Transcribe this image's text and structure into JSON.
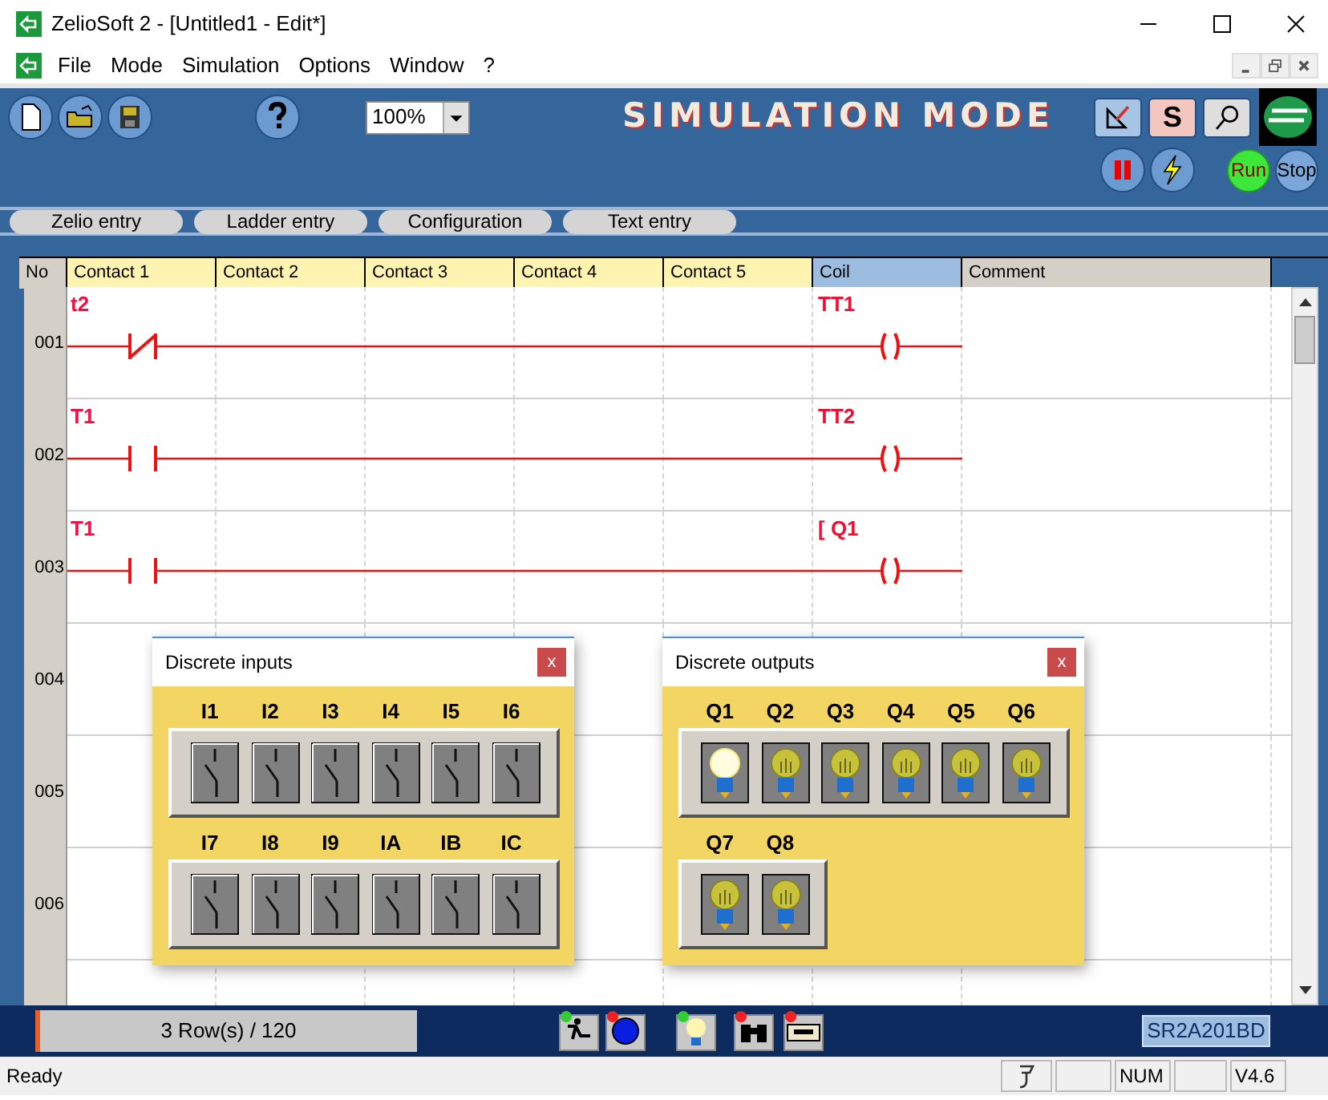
{
  "window": {
    "title": "ZelioSoft 2 - [Untitled1 - Edit*]"
  },
  "menu": [
    "File",
    "Mode",
    "Simulation",
    "Options",
    "Window",
    "?"
  ],
  "toolbar": {
    "zoom": "100%",
    "mode_banner": "SIMULATION MODE",
    "s_button": "S",
    "run_button": "Run",
    "stop_button": "Stop"
  },
  "tabs": [
    "Zelio entry",
    "Ladder entry",
    "Configuration",
    "Text entry"
  ],
  "ladder": {
    "columns": [
      {
        "label": "No",
        "kind": "index"
      },
      {
        "label": "Contact 1",
        "kind": "contact"
      },
      {
        "label": "Contact 2",
        "kind": "contact"
      },
      {
        "label": "Contact 3",
        "kind": "contact"
      },
      {
        "label": "Contact 4",
        "kind": "contact"
      },
      {
        "label": "Contact 5",
        "kind": "contact"
      },
      {
        "label": "Coil",
        "kind": "coil"
      },
      {
        "label": "Comment",
        "kind": "comment"
      }
    ],
    "rows": [
      {
        "no": "001",
        "contacts": [
          {
            "label": "t2",
            "kind": "nc"
          }
        ],
        "coil": {
          "label": "TT1"
        }
      },
      {
        "no": "002",
        "contacts": [
          {
            "label": "T1",
            "kind": "no"
          }
        ],
        "coil": {
          "label": "TT2"
        }
      },
      {
        "no": "003",
        "contacts": [
          {
            "label": "T1",
            "kind": "no"
          }
        ],
        "coil": {
          "label": "[ Q1"
        }
      },
      {
        "no": "004"
      },
      {
        "no": "005"
      },
      {
        "no": "006"
      }
    ]
  },
  "discrete_inputs": {
    "title": "Discrete inputs",
    "close": "x",
    "items": [
      {
        "label": "I1",
        "on": false
      },
      {
        "label": "I2",
        "on": false
      },
      {
        "label": "I3",
        "on": false
      },
      {
        "label": "I4",
        "on": false
      },
      {
        "label": "I5",
        "on": false
      },
      {
        "label": "I6",
        "on": false
      },
      {
        "label": "I7",
        "on": false
      },
      {
        "label": "I8",
        "on": false
      },
      {
        "label": "I9",
        "on": false
      },
      {
        "label": "IA",
        "on": false
      },
      {
        "label": "IB",
        "on": false
      },
      {
        "label": "IC",
        "on": false
      }
    ]
  },
  "discrete_outputs": {
    "title": "Discrete outputs",
    "close": "x",
    "items": [
      {
        "label": "Q1",
        "on": true
      },
      {
        "label": "Q2",
        "on": false
      },
      {
        "label": "Q3",
        "on": false
      },
      {
        "label": "Q4",
        "on": false
      },
      {
        "label": "Q5",
        "on": false
      },
      {
        "label": "Q6",
        "on": false
      },
      {
        "label": "Q7",
        "on": false
      },
      {
        "label": "Q8",
        "on": false
      }
    ]
  },
  "bottom_bar": {
    "rows": "3 Row(s) / 120",
    "module": "SR2A201BD",
    "tools": [
      {
        "kind": "person",
        "color": "#33cc33"
      },
      {
        "kind": "disc",
        "color": "#ee2222"
      },
      {
        "kind": "bulb",
        "color": "#33cc33"
      },
      {
        "kind": "binoculars",
        "color": "#ee2222"
      },
      {
        "kind": "panel",
        "color": "#ee2222"
      }
    ]
  },
  "status_bar": {
    "message": "Ready",
    "cells": [
      {
        "kind": "icon"
      },
      {
        "kind": "empty"
      },
      {
        "kind": "text",
        "text": "NUM"
      },
      {
        "kind": "empty"
      },
      {
        "kind": "text",
        "text": "V4.6"
      }
    ]
  }
}
